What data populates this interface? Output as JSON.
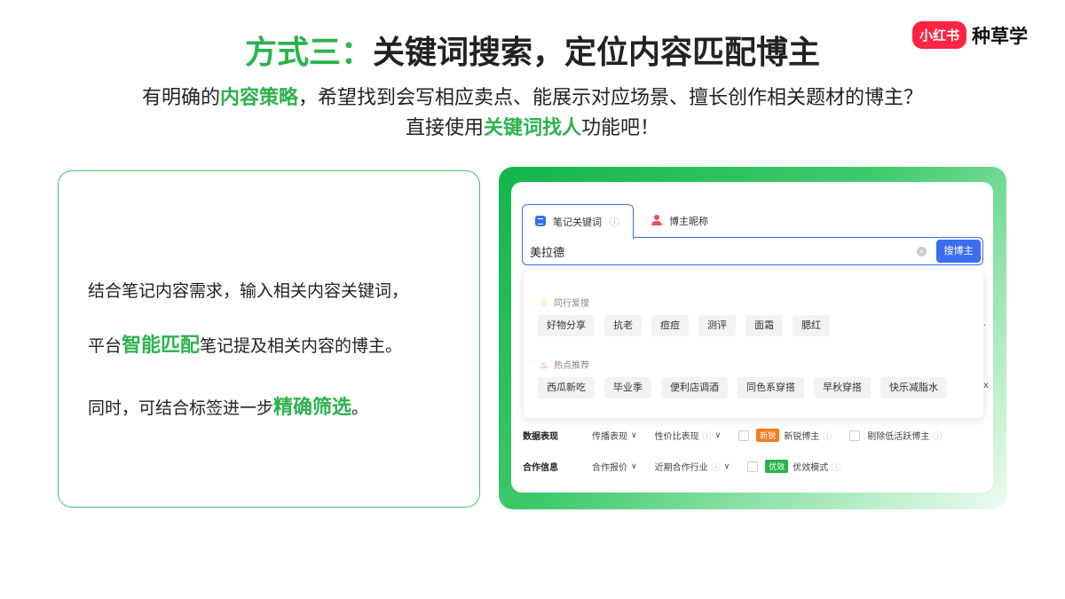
{
  "header": {
    "title_prefix": "方式三：",
    "title_main": "关键词搜索，定位内容匹配博主",
    "logo_badge": "小红书",
    "logo_text": "种草学"
  },
  "subtitle": {
    "line1_a": "有明确的",
    "line1_hl": "内容策略",
    "line1_b": "，希望找到会写相应卖点、能展示对应场景、擅长创作相关题材的博主？",
    "line2_a": "直接使用",
    "line2_hl": "关键词找人",
    "line2_b": "功能吧！"
  },
  "left_card": {
    "p1": "结合笔记内容需求，输入相关内容关键词，",
    "p2_a": "平台",
    "p2_hl": "智能匹配",
    "p2_b": "笔记提及相关内容的博主。",
    "p3_a": "同时，可结合标签进一步",
    "p3_hl": "精确筛选",
    "p3_b": "。"
  },
  "search_ui": {
    "tabs": [
      {
        "label": "笔记关键词",
        "info_icon": "ⓘ"
      },
      {
        "label": "博主昵称"
      }
    ],
    "query": "美拉德",
    "clear_icon": "×",
    "search_button": "搜博主",
    "sections": [
      {
        "title": "同行爱搜",
        "icon": "☆",
        "chips": [
          "好物分享",
          "抗老",
          "痘痘",
          "测评",
          "面霜",
          "腮红"
        ]
      },
      {
        "title": "热点推荐",
        "icon": "♨",
        "chips": [
          "西瓜新吃",
          "毕业季",
          "便利店调酒",
          "同色系穿搭",
          "早秋穿搭",
          "快乐减脂水"
        ]
      }
    ],
    "edge_glyph_1": "·",
    "edge_glyph_2": "x",
    "filters": [
      {
        "title": "数据表现",
        "dropdowns": [
          {
            "label": "传播表现",
            "info": false
          },
          {
            "label": "性价比表现",
            "info": true
          }
        ],
        "checkboxes": [
          {
            "tag": "新锐",
            "tag_type": "new",
            "label": "新锐博主"
          },
          {
            "tag": "",
            "tag_type": "",
            "label": "剔除低活跃博主"
          }
        ]
      },
      {
        "title": "合作信息",
        "dropdowns": [
          {
            "label": "合作报价",
            "info": false
          },
          {
            "label": "近期合作行业",
            "info": true
          }
        ],
        "checkboxes": [
          {
            "tag": "优效",
            "tag_type": "eff",
            "label": "优效模式"
          }
        ]
      }
    ],
    "info_glyph": "ⓘ",
    "chevron_glyph": "∨"
  },
  "colors": {
    "accent_green": "#2bb24c",
    "brand_red": "#ff2442",
    "primary_blue": "#3a6df0",
    "tag_orange": "#f47c22"
  }
}
